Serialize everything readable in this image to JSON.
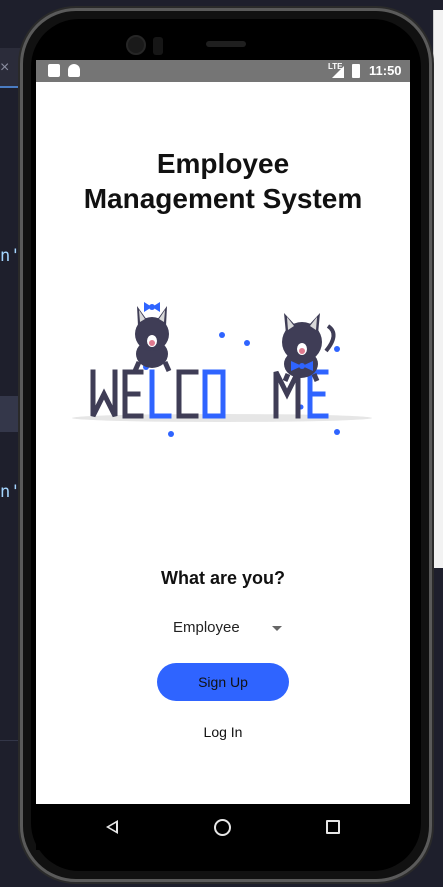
{
  "status_bar": {
    "time": "11:50",
    "network": "LTE"
  },
  "app": {
    "title_line1": "Employee",
    "title_line2": "Management System",
    "welcome_image_text": "WELCOME",
    "question": "What are you?",
    "role_select": {
      "selected": "Employee"
    },
    "signup_label": "Sign Up",
    "login_label": "Log In"
  },
  "editor": {
    "code_line_1": "n'",
    "code_line_2": "n'",
    "tab_close_glyph": "×"
  },
  "icons": [
    "close-icon",
    "back-icon",
    "home-icon",
    "recents-icon",
    "signal-icon",
    "battery-icon"
  ],
  "colors": {
    "accent": "#2f64ff",
    "status_bar": "#757575",
    "editor_bg": "#1e1f2c"
  }
}
